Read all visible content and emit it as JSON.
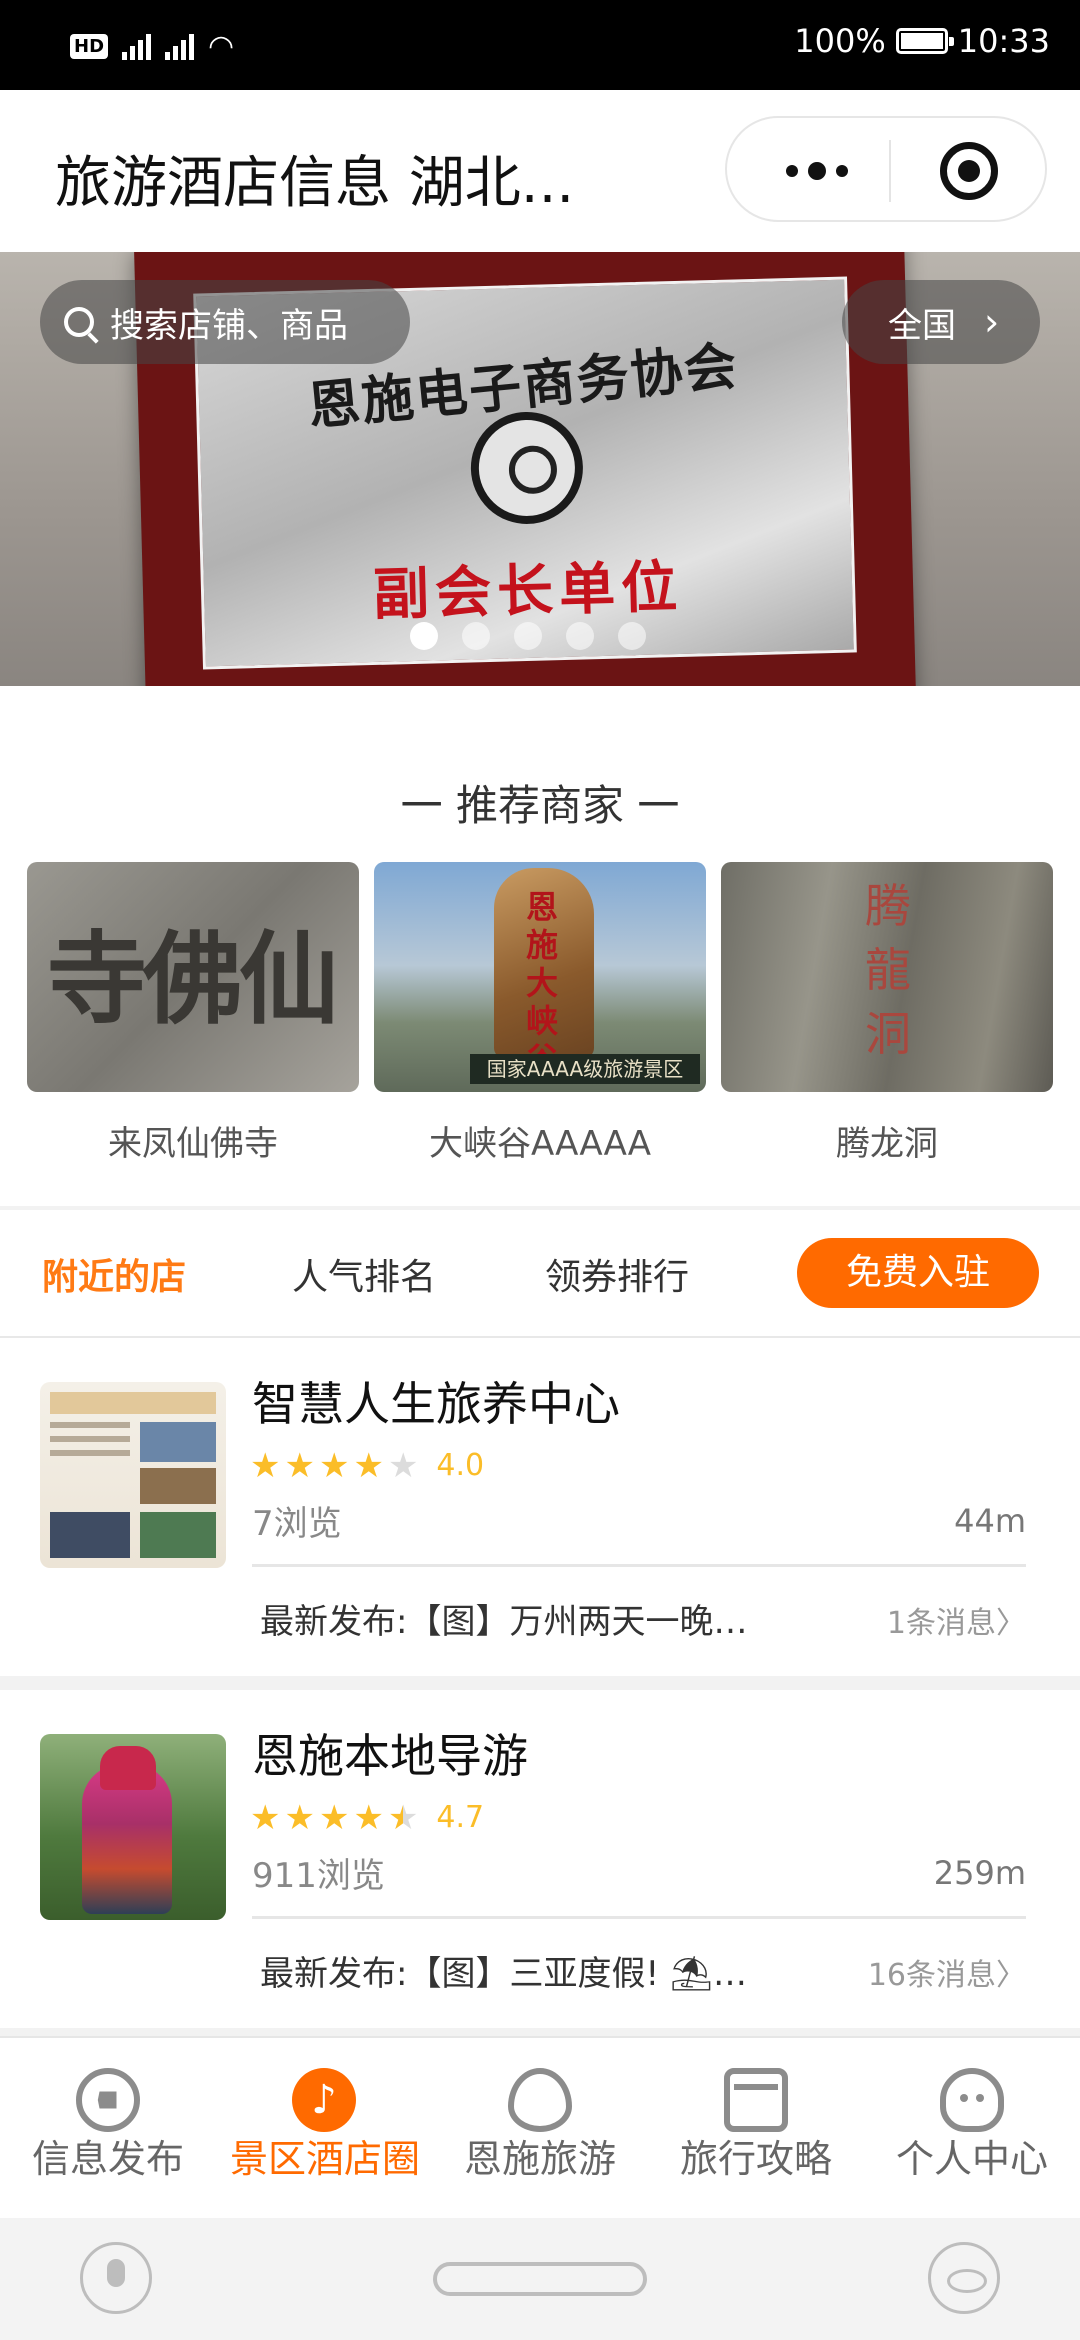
{
  "status_bar": {
    "left_icons": [
      "hd-icon",
      "signal-4g-icon",
      "signal-4g-icon",
      "wifi-icon"
    ],
    "battery_percent": "100%",
    "time": "10:33"
  },
  "header": {
    "title": "旅游酒店信息  湖北..."
  },
  "banner": {
    "search_placeholder": "搜索店铺、商品",
    "region_label": "全国",
    "slide_count": 5,
    "active_slide": 1,
    "plaque_title": "恩施电子商务协会",
    "plaque_subtitle": "副会长单位"
  },
  "recommended": {
    "title": "一  推荐商家  一",
    "items": [
      {
        "name": "来凤仙佛寺",
        "image_text": "寺佛仙"
      },
      {
        "name": "大峡谷AAAAA",
        "image_text": "恩施大峡谷",
        "image_sign": "国家AAAA级旅游景区"
      },
      {
        "name": "腾龙洞",
        "image_text": "腾龍洞"
      }
    ]
  },
  "tabs": {
    "items": [
      "附近的店",
      "人气排名",
      "领券排行"
    ],
    "active_index": 0,
    "join_label": "免费入驻",
    "accent": "#ff6a00"
  },
  "shops": [
    {
      "name": "智慧人生旅养中心",
      "rating": "4.0",
      "stars": 4,
      "views": "7浏览",
      "distance": "44m",
      "latest": "最新发布:【图】万州两天一晚…",
      "messages": "1条消息〉"
    },
    {
      "name": "恩施本地导游",
      "rating": "4.7",
      "stars": 4.5,
      "views": "911浏览",
      "distance": "259m",
      "latest": "最新发布:【图】三亚度假! ⛱…",
      "messages": "16条消息〉"
    }
  ],
  "tabbar": {
    "items": [
      {
        "label": "信息发布",
        "icon": "compass-icon"
      },
      {
        "label": "景区酒店圈",
        "icon": "music-note-icon"
      },
      {
        "label": "恩施旅游",
        "icon": "flame-icon"
      },
      {
        "label": "旅行攻略",
        "icon": "store-icon"
      },
      {
        "label": "个人中心",
        "icon": "ghost-icon"
      }
    ],
    "active_index": 1
  },
  "navbar": {
    "icons": [
      "microphone-icon",
      "home-pill-icon",
      "eye-icon"
    ]
  }
}
